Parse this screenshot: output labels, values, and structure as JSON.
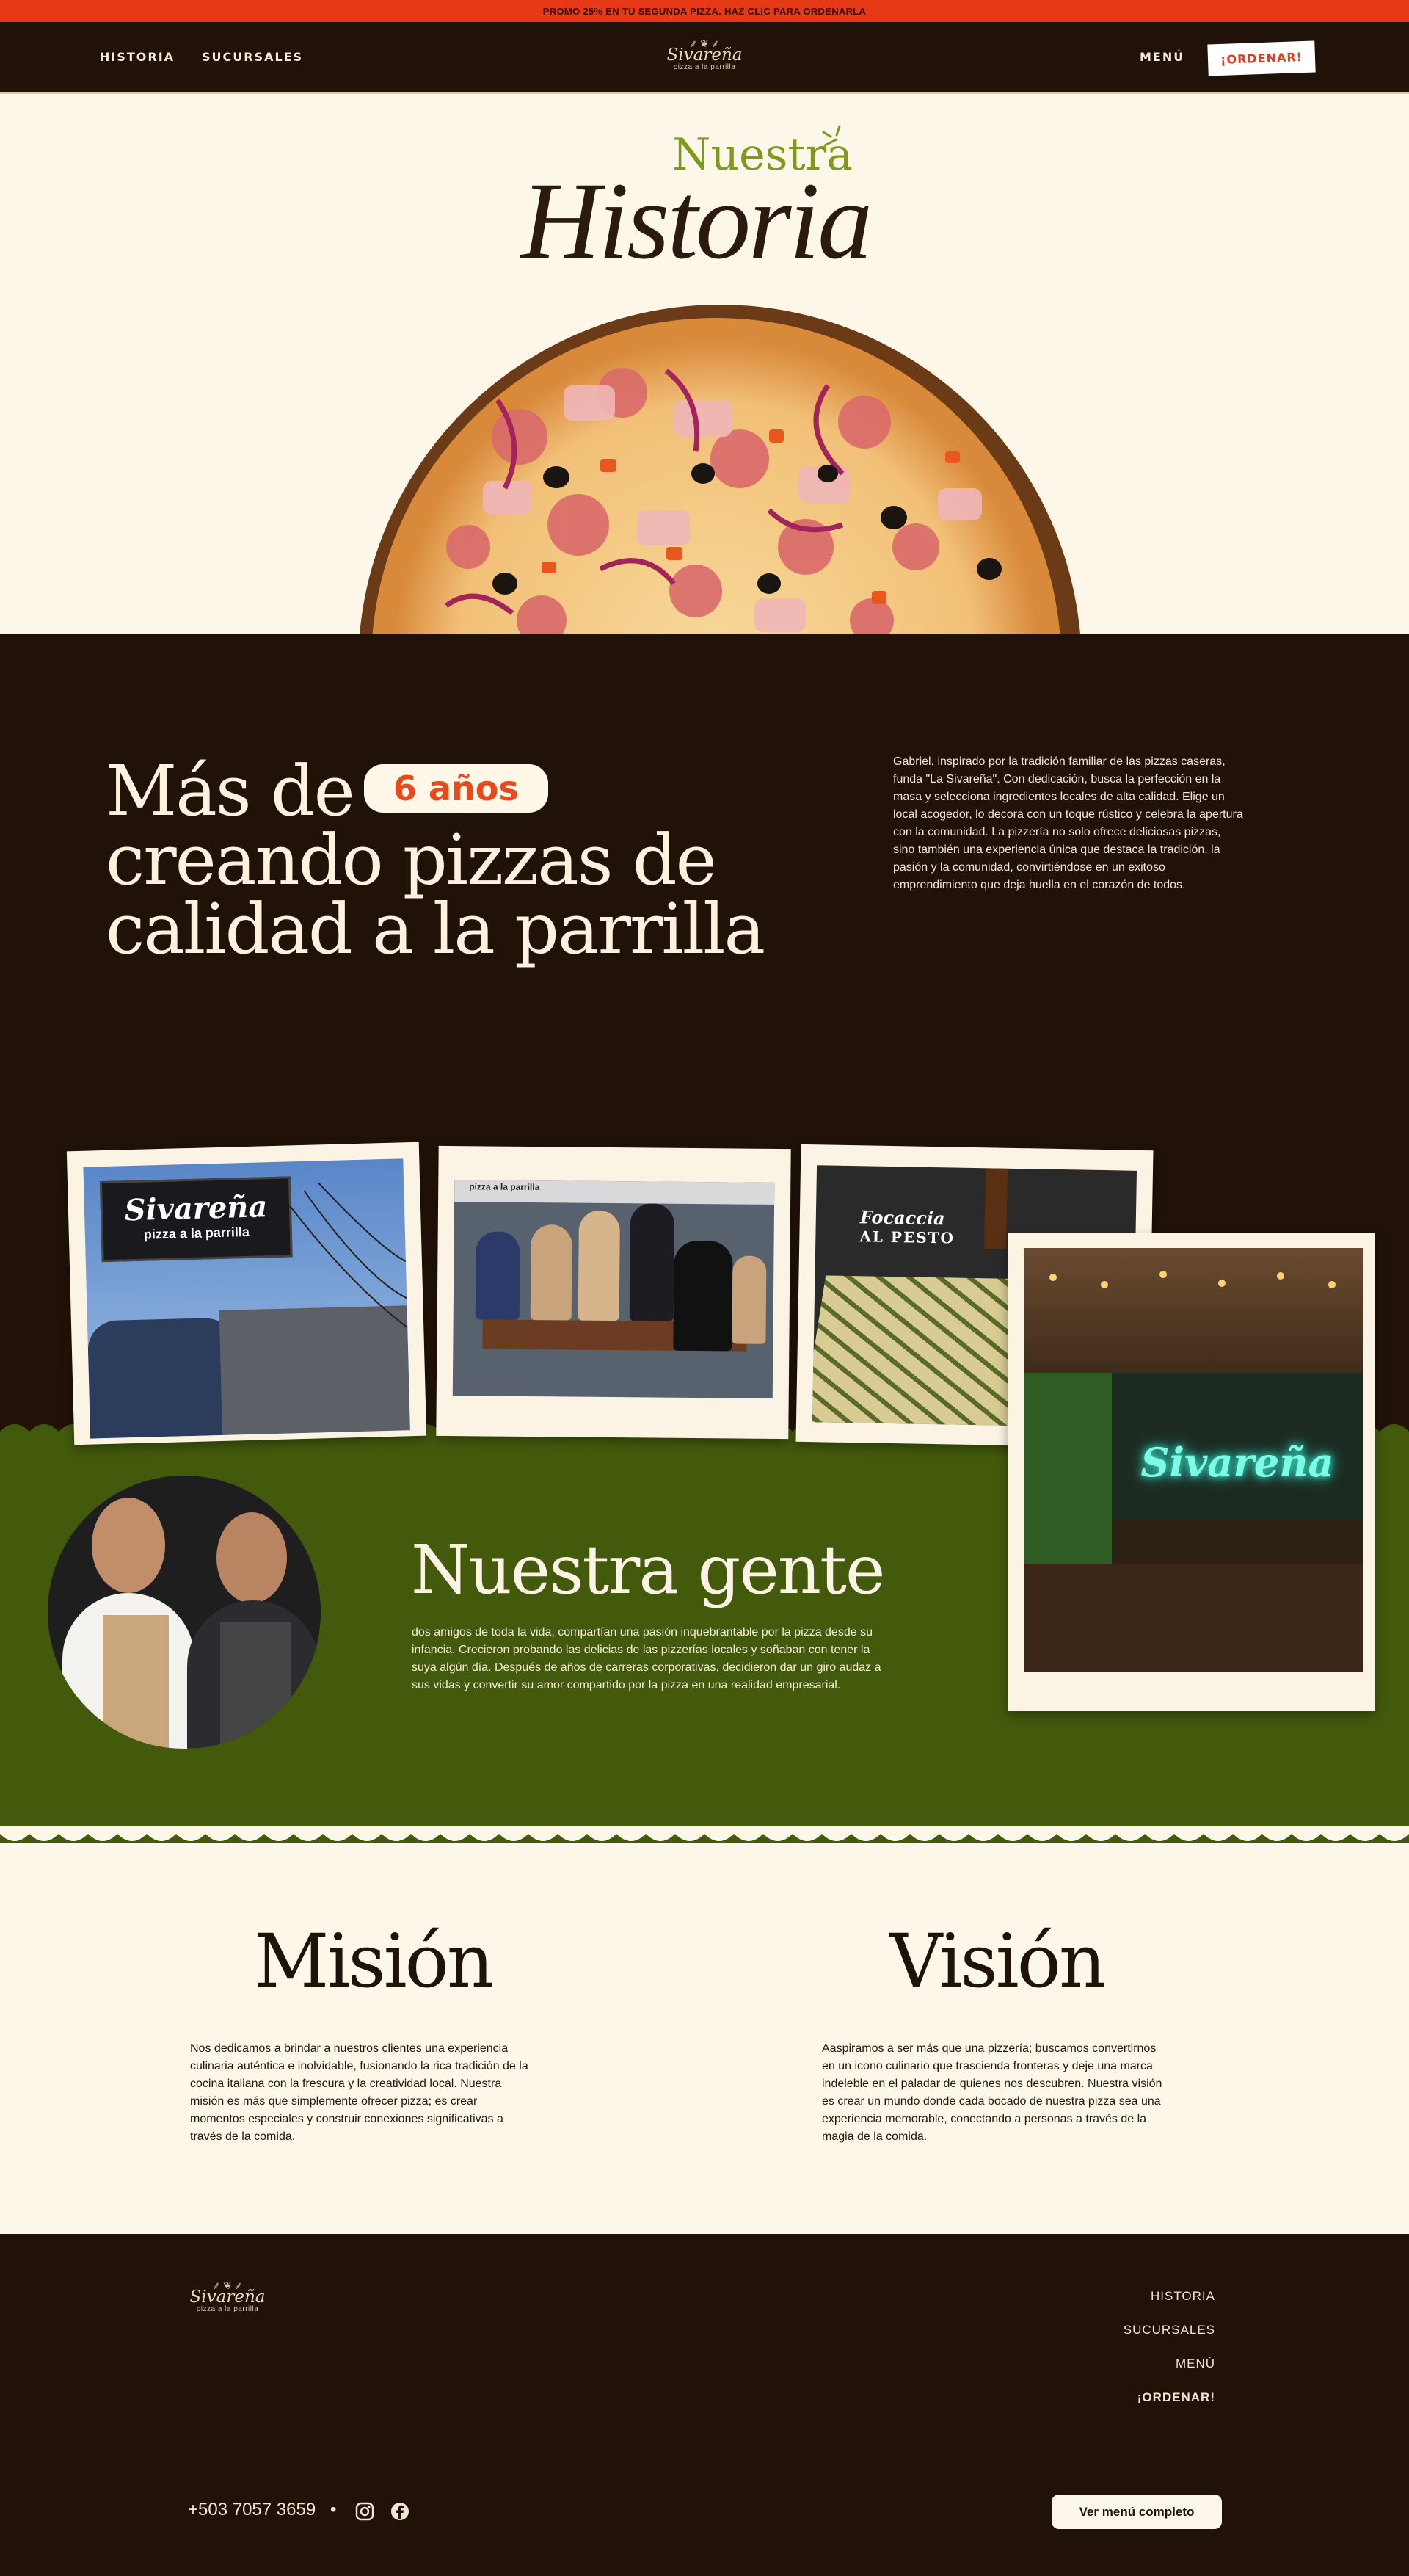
{
  "promo": {
    "text": "PROMO 25% EN TU SEGUNDA PIZZA. HAZ CLIC PARA ORDENARLA"
  },
  "nav": {
    "historia": "HISTORIA",
    "sucursales": "SUCURSALES",
    "menu": "MENÚ",
    "order": "¡ORDENAR!"
  },
  "logo": {
    "name": "Sivareña",
    "tagline": "pizza a la parrilla"
  },
  "hero": {
    "title_small": "Nuestra",
    "title_script": "Historia"
  },
  "about": {
    "head_pre": "Más de",
    "badge": "6 años",
    "head_line2": "creando pizzas de",
    "head_line3": "calidad a la parrilla",
    "paragraph": "Gabriel, inspirado por la tradición familiar de las pizzas caseras, funda \"La Sivareña\". Con dedicación, busca la perfección en la masa y selecciona ingredientes locales de alta calidad. Elige un local acogedor, lo decora con un toque rústico y celebra la apertura con la comunidad. La pizzería no solo ofrece deliciosas pizzas, sino también una experiencia única que destaca la tradición, la pasión y la comunidad, convirtiéndose en un exitoso emprendimiento que deja huella en el corazón de todos."
  },
  "photos": {
    "sign_name": "Sivareña",
    "sign_sub": "pizza a la parrilla",
    "team_sign": "pizza a la parrilla",
    "focaccia_line1": "Focaccia",
    "focaccia_line2": "AL PESTO",
    "neon": "Sivareña"
  },
  "gente": {
    "title": "Nuestra gente",
    "paragraph": "dos amigos de toda la vida, compartían una pasión inquebrantable por la pizza desde su infancia. Crecieron probando las delicias de las pizzerías locales y soñaban con tener la suya algún día. Después de años de carreras corporativas, decidieron dar un giro audaz a sus vidas y convertir su amor compartido por la pizza en una realidad empresarial."
  },
  "mision": {
    "title": "Misión",
    "text": "Nos dedicamos a brindar a nuestros clientes una experiencia culinaria auténtica e inolvidable, fusionando la rica tradición de la cocina italiana con la frescura y la creatividad local. Nuestra misión es más que simplemente ofrecer pizza; es crear momentos especiales y construir conexiones significativas a través de la comida."
  },
  "vision": {
    "title": "Visión",
    "text": "Aaspiramos a ser más que una pizzería; buscamos convertirnos en un icono culinario que trascienda fronteras y deje una marca indeleble en el paladar de quienes nos descubren. Nuestra visión es crear un mundo donde cada bocado de nuestra pizza sea una experiencia memorable, conectando a personas a través de la magia de la comida."
  },
  "footer": {
    "links": [
      "HISTORIA",
      "SUCURSALES",
      "MENÚ",
      "¡ORDENAR!"
    ],
    "phone": "+503 7057 3659",
    "separator": "•",
    "menu_button": "Ver menú completo",
    "social_icons": [
      "instagram-icon",
      "facebook-icon"
    ]
  },
  "colors": {
    "promo_bar": "#e63a17",
    "dark_brown": "#201209",
    "cream": "#fcf7e8",
    "olive_green": "#435a0d",
    "accent_green": "#7e9a1e",
    "accent_red": "#e23b1e"
  }
}
